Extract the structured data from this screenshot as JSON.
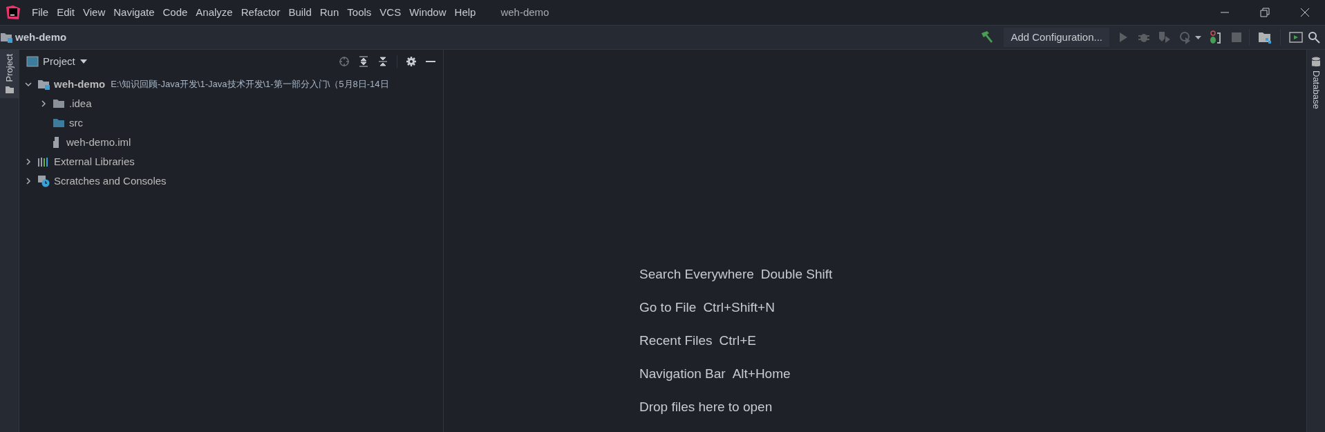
{
  "menu": [
    "File",
    "Edit",
    "View",
    "Navigate",
    "Code",
    "Analyze",
    "Refactor",
    "Build",
    "Run",
    "Tools",
    "VCS",
    "Window",
    "Help"
  ],
  "window": {
    "title": "weh-demo"
  },
  "navbar": {
    "project": "weh-demo",
    "run_config": "Add Configuration..."
  },
  "left_strip": {
    "tab": "Project"
  },
  "right_strip": {
    "tab": "Database"
  },
  "project_panel": {
    "title": "Project",
    "tree": [
      {
        "kind": "module",
        "label": "weh-demo",
        "path": "E:\\知识回顾-Java开发\\1-Java技术开发\\1-第一部分入门\\（5月8日-14日",
        "expanded": true,
        "children": [
          {
            "kind": "folder",
            "label": ".idea",
            "expanded": false
          },
          {
            "kind": "source",
            "label": "src"
          },
          {
            "kind": "file",
            "label": "weh-demo.iml"
          }
        ]
      },
      {
        "kind": "libraries",
        "label": "External Libraries",
        "expanded": false
      },
      {
        "kind": "scratches",
        "label": "Scratches and Consoles",
        "expanded": false
      }
    ]
  },
  "welcome": [
    {
      "action": "Search Everywhere",
      "shortcut": "Double Shift"
    },
    {
      "action": "Go to File",
      "shortcut": "Ctrl+Shift+N"
    },
    {
      "action": "Recent Files",
      "shortcut": "Ctrl+E"
    },
    {
      "action": "Navigation Bar",
      "shortcut": "Alt+Home"
    },
    {
      "action": "Drop files here to open"
    }
  ]
}
